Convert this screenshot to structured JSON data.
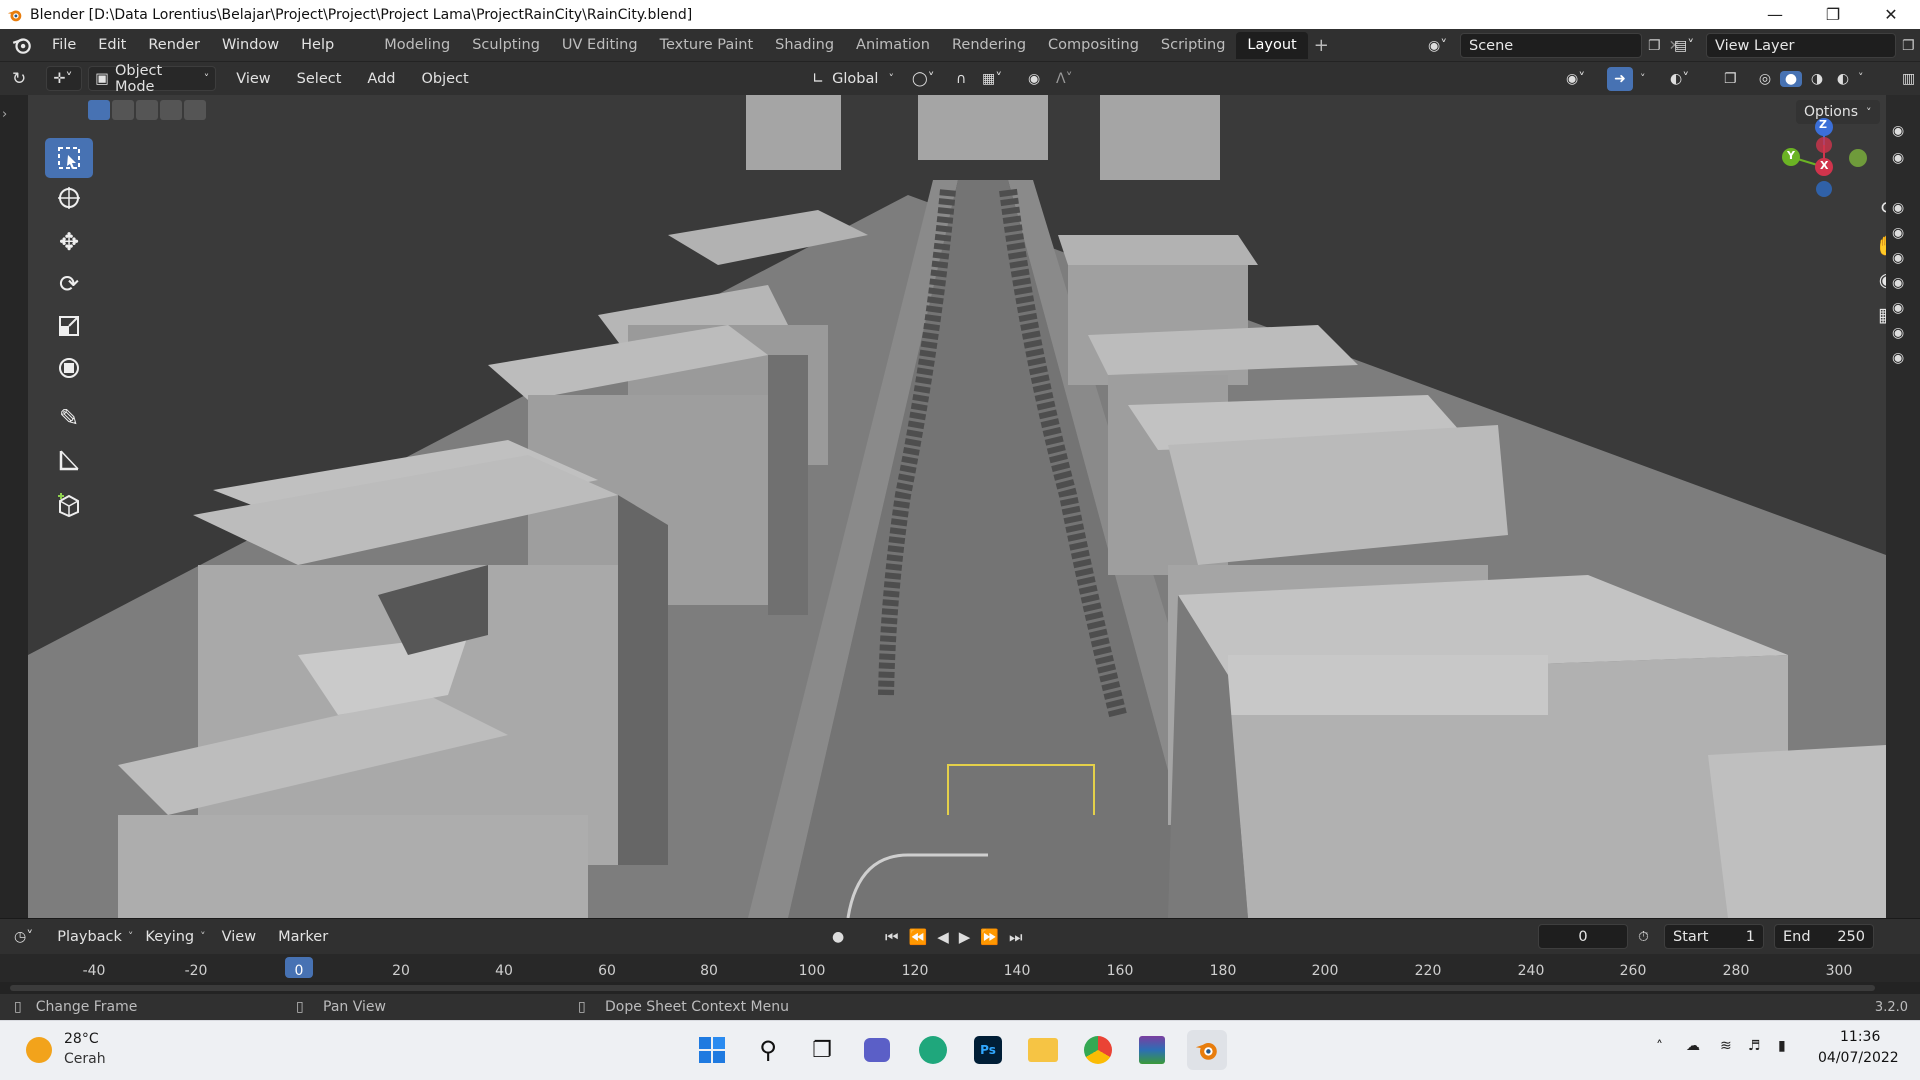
{
  "window": {
    "title": "Blender [D:\\Data Lorentius\\Belajar\\Project\\Project\\Project Lama\\ProjectRainCity\\RainCity.blend]",
    "controls": [
      "minimize-icon",
      "restore-icon",
      "close-icon"
    ]
  },
  "menu": [
    "File",
    "Edit",
    "Render",
    "Window",
    "Help"
  ],
  "workspaces": [
    "Modeling",
    "Sculpting",
    "UV Editing",
    "Texture Paint",
    "Shading",
    "Animation",
    "Rendering",
    "Compositing",
    "Scripting",
    "Layout"
  ],
  "active_workspace": "Layout",
  "scene": {
    "label": "Scene"
  },
  "view_layer": {
    "label": "View Layer"
  },
  "viewport_header": {
    "mode": "Object Mode",
    "menus": [
      "View",
      "Select",
      "Add",
      "Object"
    ],
    "transform_orientation": "Global",
    "options_label": "Options"
  },
  "gizmo": {
    "x": "X",
    "y": "Y",
    "z": "Z"
  },
  "colors": {
    "accent": "#4772b3",
    "viewport_bg": "#393939",
    "header": "#303030",
    "current_frame": "#4772b3"
  },
  "timeline": {
    "menus": [
      "Playback",
      "Keying",
      "View",
      "Marker"
    ],
    "current_frame": "0",
    "start_label": "Start",
    "start": "1",
    "end_label": "End",
    "end": "250",
    "ticks": [
      "-40",
      "-20",
      "0",
      "20",
      "40",
      "60",
      "80",
      "100",
      "120",
      "140",
      "160",
      "180",
      "200",
      "220",
      "240",
      "260",
      "280",
      "300"
    ]
  },
  "statusbar": {
    "items": [
      "Change Frame",
      "Pan View",
      "Dope Sheet Context Menu"
    ],
    "version": "3.2.0"
  },
  "taskbar": {
    "weather_temp": "28°C",
    "weather_desc": "Cerah",
    "time": "11:36",
    "date": "04/07/2022"
  }
}
